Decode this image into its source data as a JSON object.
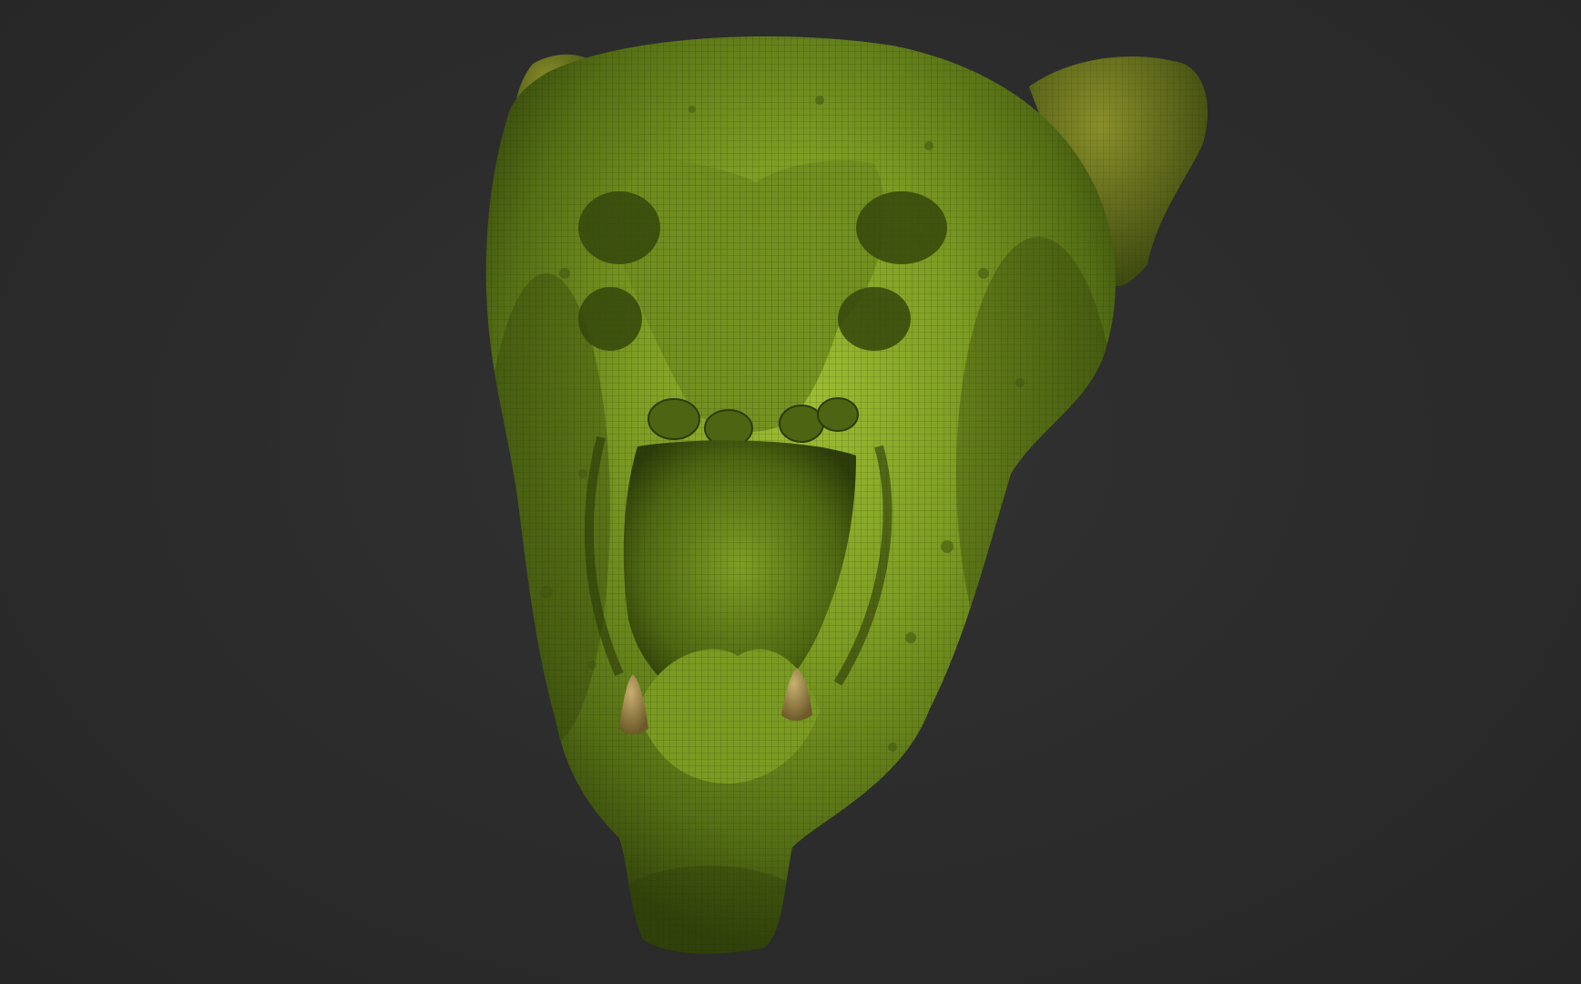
{
  "viewport": {
    "background_color": "#2c2c2c",
    "model": {
      "icon": "creature-head-sculpt",
      "material_color": "#6f8f1f",
      "shadow_color": "#2f3f0c",
      "highlight_color": "#a3c23a",
      "wireframe_color": "#1f2a08"
    }
  }
}
